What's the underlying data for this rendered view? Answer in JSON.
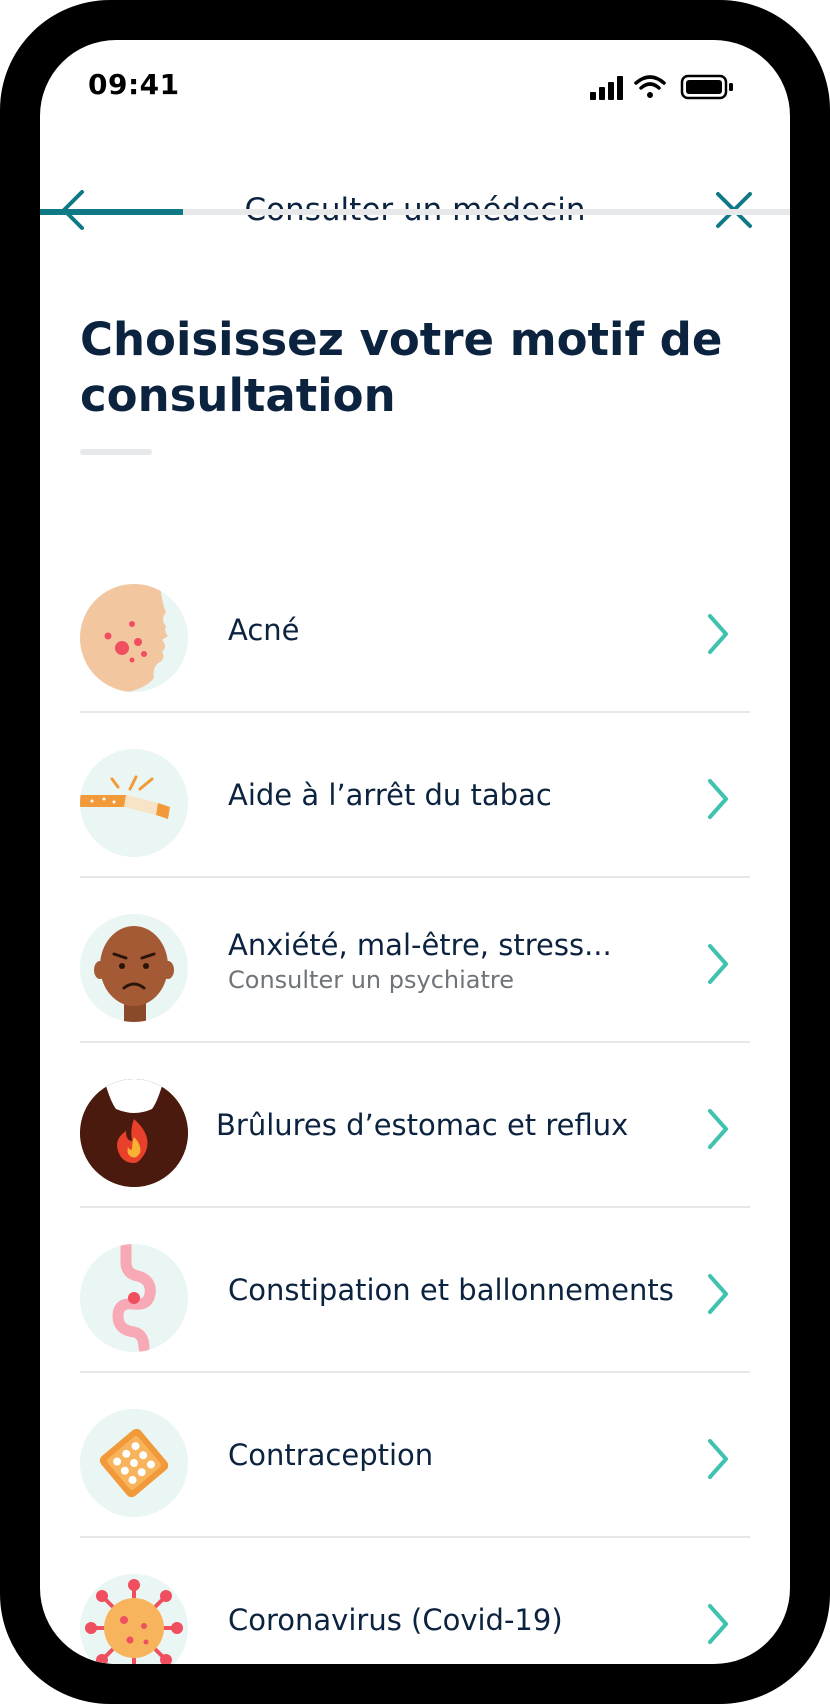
{
  "status_bar": {
    "time": "09:41"
  },
  "header": {
    "title": "Consulter un médecin",
    "progress": 0.19
  },
  "page": {
    "heading": "Choisissez votre motif de consultation"
  },
  "items": [
    {
      "label": "Acné",
      "sublabel": "",
      "icon": "acne-face-icon"
    },
    {
      "label": "Aide à l’arrêt du tabac",
      "sublabel": "",
      "icon": "broken-cigarette-icon"
    },
    {
      "label": "Anxiété, mal-être, stress...",
      "sublabel": "Consulter un psychiatre",
      "icon": "worried-face-icon"
    },
    {
      "label": "Brûlures d’estomac et reflux",
      "sublabel": "",
      "icon": "heartburn-icon"
    },
    {
      "label": "Constipation et ballonnements",
      "sublabel": "",
      "icon": "intestine-icon"
    },
    {
      "label": "Contraception",
      "sublabel": "",
      "icon": "pill-pack-icon"
    },
    {
      "label": "Coronavirus (Covid-19)",
      "sublabel": "",
      "icon": "virus-icon"
    }
  ],
  "colors": {
    "primary": "#0c2340",
    "accent": "#0f7a85",
    "chevron": "#3fc2b0",
    "icon_bg": "#eaf6f4"
  }
}
